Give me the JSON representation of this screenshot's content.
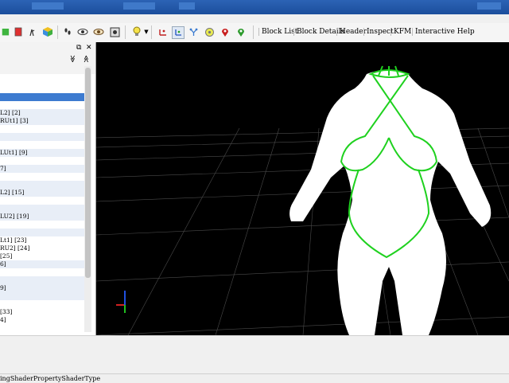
{
  "toolbar": {
    "tabs": [
      "Block List",
      "Block Details",
      "Header",
      "Inspect",
      "KFM",
      "Interactive Help"
    ]
  },
  "panel": {
    "float_icon": "⧉",
    "close_icon": "✕",
    "collapse_icon": "≫",
    "expand_icon": "≪"
  },
  "tree": {
    "rows": [
      {
        "text": "",
        "style": "sel"
      },
      {
        "text": "L2] [2]",
        "style": "alt"
      },
      {
        "text": "RUt1] [3]",
        "style": "alt"
      },
      {
        "text": "",
        "style": "alt"
      },
      {
        "text": "LUt1] [9]",
        "style": "alt"
      },
      {
        "text": "7]",
        "style": "alt"
      },
      {
        "text": "",
        "style": "alt"
      },
      {
        "text": "L2] [15]",
        "style": "alt"
      },
      {
        "text": "",
        "style": "alt"
      },
      {
        "text": "LU2] [19]",
        "style": "alt"
      },
      {
        "text": "",
        "style": "alt"
      },
      {
        "text": "Lt1] [23]",
        "style": ""
      },
      {
        "text": "RU2] [24]",
        "style": ""
      },
      {
        "text": " [25]",
        "style": ""
      },
      {
        "text": "6]",
        "style": "alt"
      },
      {
        "text": "",
        "style": "alt"
      },
      {
        "text": "9]",
        "style": "alt"
      },
      {
        "text": "",
        "style": "alt"
      },
      {
        "text": " [33]",
        "style": ""
      },
      {
        "text": "4]",
        "style": ""
      }
    ]
  },
  "status": {
    "text": "ingShaderPropertyShaderType"
  },
  "colors": {
    "viewport_bg": "#000000",
    "mesh_fill": "#ffffff",
    "mesh_outline": "#1fd11f",
    "selection": "#3d7bd0"
  }
}
